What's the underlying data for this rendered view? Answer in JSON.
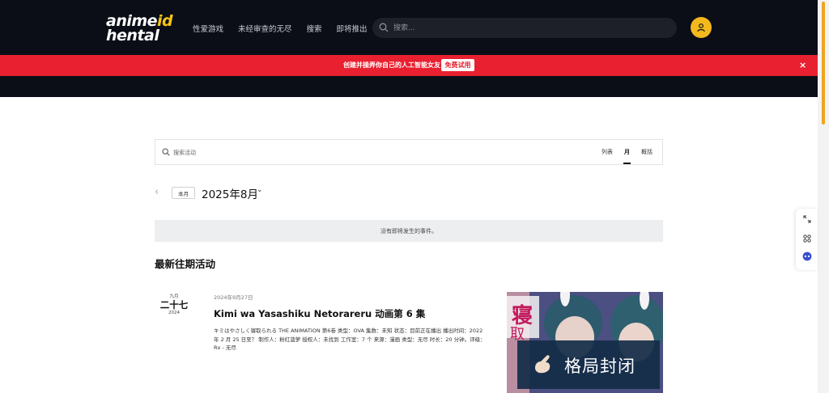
{
  "header": {
    "logo": {
      "line1": "anime",
      "line1_accent": "id",
      "line2": "hental",
      "line2_accent": ""
    },
    "nav": [
      "性爱游戏",
      "未经审查的无尽",
      "搜索",
      "即将推出"
    ],
    "search_placeholder": "搜索..."
  },
  "promo": {
    "text": "创建并操弄你自己的人工智能女友",
    "button": "免费试用",
    "close": "×"
  },
  "events": {
    "search_placeholder": "搜索活动",
    "views": [
      "列表",
      "月",
      "概括"
    ],
    "active_view": "月",
    "prev": "‹",
    "this_month": "本月",
    "month_title": "2025年8月",
    "month_caret": "⌄",
    "no_events": "没有即将发生的事件。",
    "section_title": "最新往期活动"
  },
  "post": {
    "badge_month": "九月",
    "badge_day": "二十七",
    "badge_year": "2024",
    "date": "2024年9月27日",
    "title": "Kimi wa Yasashiku Netorareru 动画第 6 集",
    "description": "キミはやさしく寝取られる THE ANIMATION 第6卷 类型：OVA 集数：未知 状态：目前正在播出 播出时间：2022 年 2 月 25 日至？ 制作人：粉红菠萝 授权人：未找到 工作室：7 个 来源：漫画 类型：无尽 时长：20 分钟。评级：Rx - 无尽"
  },
  "overlay": {
    "text": "格局封闭"
  },
  "colors": {
    "header_bg": "#0b0e17",
    "promo_red": "#e8202f",
    "accent_yellow": "#f3b81e",
    "overlay_navy": "#142c48"
  }
}
